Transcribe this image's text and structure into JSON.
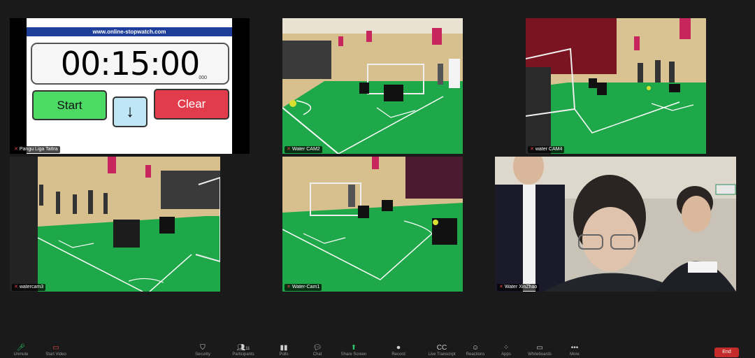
{
  "stopwatch": {
    "url": "www.online-stopwatch.com",
    "time": "00:15:00",
    "milliseconds": "000",
    "start_label": "Start",
    "down_label": "↓",
    "clear_label": "Clear"
  },
  "tiles": [
    {
      "name": "Pangu Liga Tattra"
    },
    {
      "name": "Water CAM2"
    },
    {
      "name": "water CAM4"
    },
    {
      "name": "watercam3"
    },
    {
      "name": "Water-Cam1"
    },
    {
      "name": "Water XinZhao"
    }
  ],
  "toolbar": {
    "participants_count": "11",
    "items": [
      {
        "label": "Unmute",
        "icon": "microphone-icon"
      },
      {
        "label": "Start Video",
        "icon": "video-off-icon"
      },
      {
        "label": "Security",
        "icon": "shield-icon"
      },
      {
        "label": "Participants",
        "icon": "participants-icon"
      },
      {
        "label": "Polls",
        "icon": "polls-icon"
      },
      {
        "label": "Chat",
        "icon": "chat-icon"
      },
      {
        "label": "Share Screen",
        "icon": "share-screen-icon"
      },
      {
        "label": "Record",
        "icon": "record-icon"
      },
      {
        "label": "Live Transcript",
        "icon": "cc-icon"
      },
      {
        "label": "Reactions",
        "icon": "reactions-icon"
      },
      {
        "label": "Apps",
        "icon": "apps-icon"
      },
      {
        "label": "Whiteboards",
        "icon": "whiteboard-icon"
      },
      {
        "label": "More",
        "icon": "more-icon"
      }
    ],
    "end_label": "End"
  },
  "colors": {
    "background": "#1a1a1a",
    "field_green": "#1fa84a",
    "end_red": "#c42c2c",
    "start_green": "#4cd964",
    "clear_red": "#e23b4c"
  }
}
